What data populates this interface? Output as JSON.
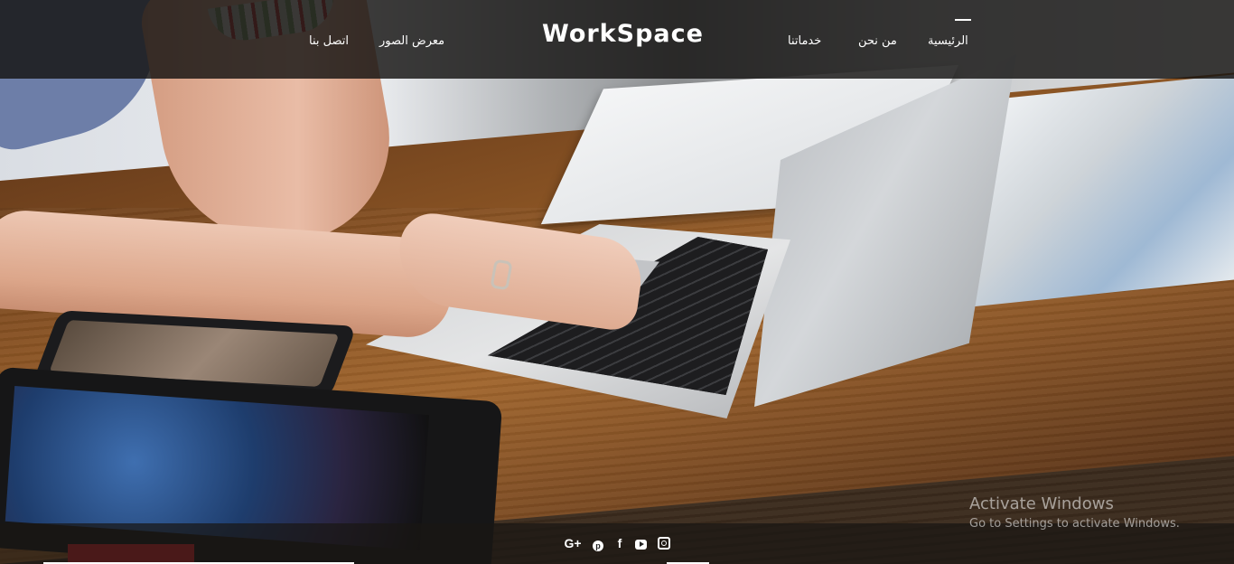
{
  "header": {
    "logo": "WorkSpace",
    "nav": [
      {
        "label": "الرئيسية",
        "active": true
      },
      {
        "label": "من نحن"
      },
      {
        "label": "خدماتنا"
      },
      {
        "label": "معرض الصور"
      },
      {
        "label": "اتصل بنا"
      }
    ]
  },
  "footer": {
    "social": [
      {
        "icon": "google-plus-icon",
        "glyph": "G+"
      },
      {
        "icon": "pinterest-icon",
        "glyph": "p"
      },
      {
        "icon": "facebook-icon",
        "glyph": "f"
      },
      {
        "icon": "youtube-icon",
        "glyph": ""
      },
      {
        "icon": "instagram-icon",
        "glyph": ""
      }
    ]
  },
  "watermark": {
    "title": "Activate Windows",
    "subtitle": "Go to Settings to activate Windows."
  },
  "colors": {
    "header_bg": "#141211",
    "text": "#ffffff"
  }
}
